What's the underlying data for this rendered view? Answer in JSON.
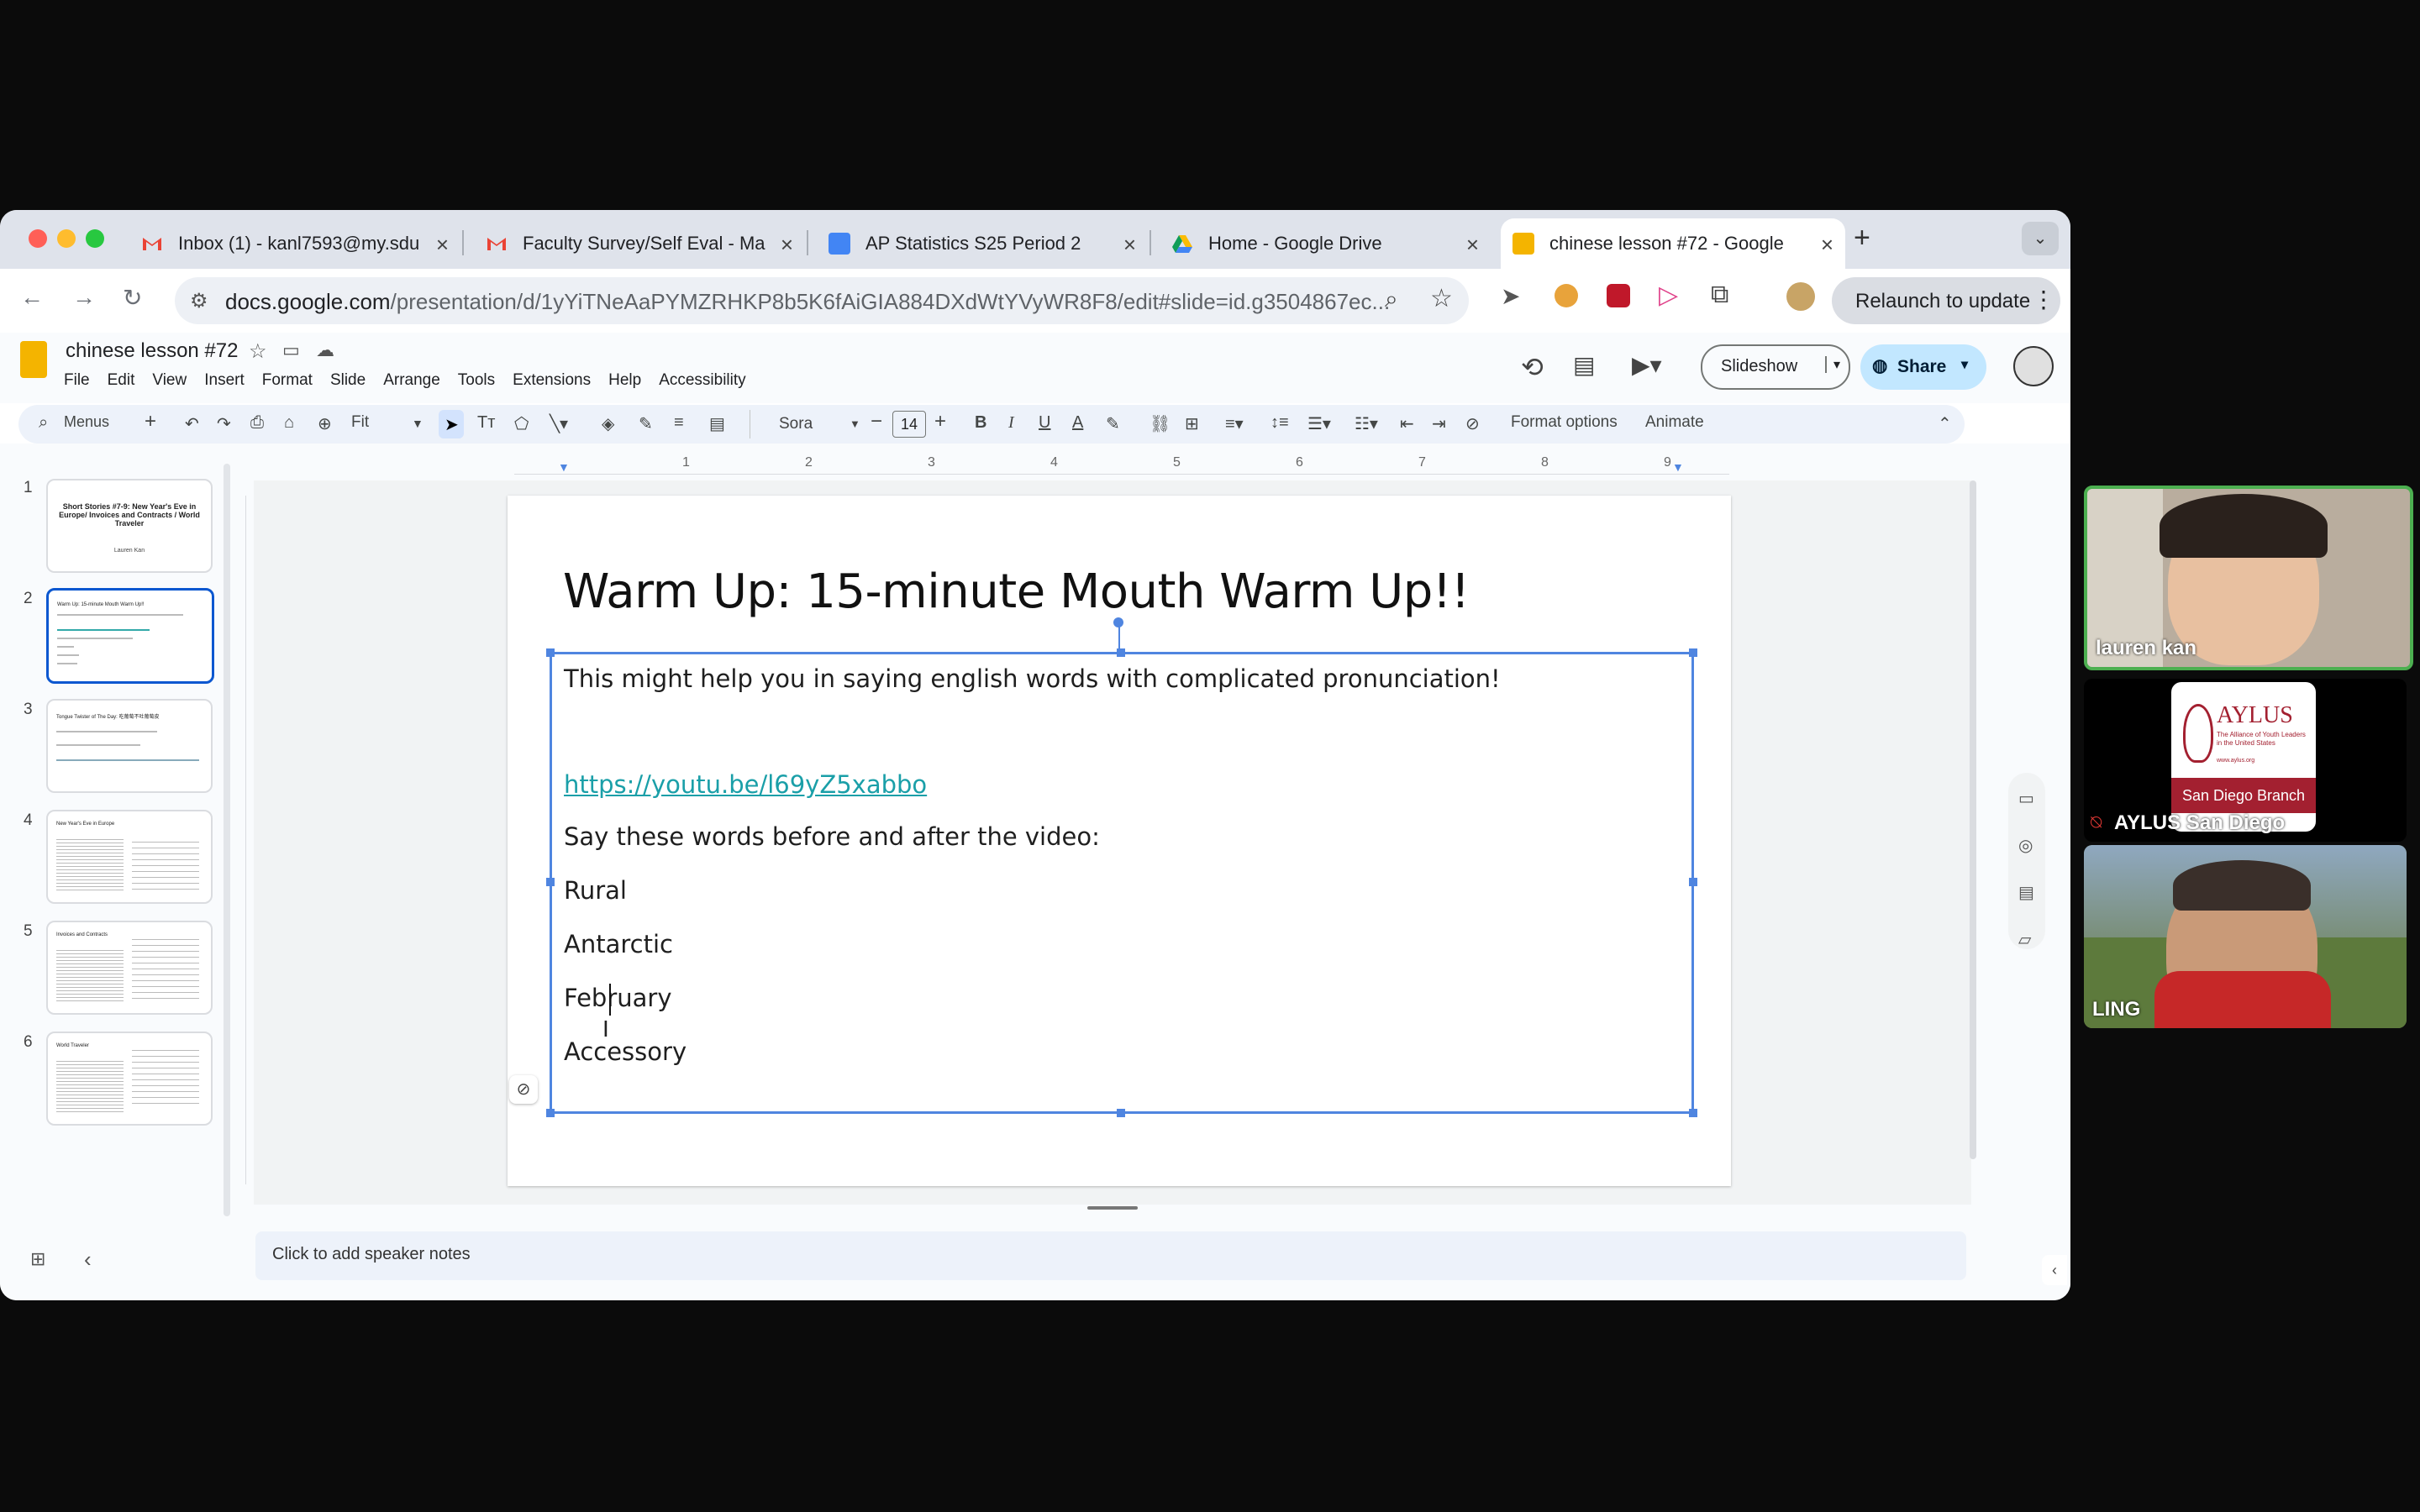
{
  "browser": {
    "tabs": [
      {
        "label": "Inbox (1) - kanl7593@my.sdu",
        "icon": "gmail-icon"
      },
      {
        "label": "Faculty Survey/Self Eval - Ma",
        "icon": "gmail-icon"
      },
      {
        "label": "AP Statistics S25 Period 2",
        "icon": "classroom-icon"
      },
      {
        "label": "Home - Google Drive",
        "icon": "drive-icon"
      },
      {
        "label": "chinese lesson #72 - Google",
        "icon": "slides-icon"
      }
    ],
    "url_domain": "docs.google.com",
    "url_path": "/presentation/d/1yYiTNeAaPYMZRHKP8b5K6fAiGIA884DXdWtYVyWR8F8/edit#slide=id.g3504867ec...",
    "relaunch_label": "Relaunch to update"
  },
  "app": {
    "doc_title": "chinese lesson #72",
    "menus": [
      "File",
      "Edit",
      "View",
      "Insert",
      "Format",
      "Slide",
      "Arrange",
      "Tools",
      "Extensions",
      "Help",
      "Accessibility"
    ],
    "slideshow_label": "Slideshow",
    "share_label": "Share",
    "toolbar": {
      "menus_label": "Menus",
      "zoom": "Fit",
      "font": "Sora",
      "font_size": "14",
      "format_options": "Format options",
      "animate": "Animate"
    },
    "ruler_ticks": [
      "1",
      "2",
      "3",
      "4",
      "5",
      "6",
      "7",
      "8",
      "9"
    ],
    "speaker_notes_placeholder": "Click to add speaker notes"
  },
  "thumbnails": [
    {
      "num": "1",
      "title": "Short Stories #7-9: New Year's Eve in Europe/ Invoices and Contracts / World Traveler",
      "author": "Lauren Kan"
    },
    {
      "num": "2",
      "title": "Warm Up: 15-minute Mouth Warm Up!!"
    },
    {
      "num": "3",
      "title": "Tongue Twister of The Day: 吃葡萄不吐葡萄皮"
    },
    {
      "num": "4",
      "title": "New Year's Eve in Europe"
    },
    {
      "num": "5",
      "title": "Invoices and Contracts"
    },
    {
      "num": "6",
      "title": "World Traveler"
    }
  ],
  "slide": {
    "title": "Warm Up: 15-minute Mouth Warm Up!!",
    "intro": "This might help you in saying english words with complicated pronunciation!",
    "link": "https://youtu.be/l69yZ5xabbo",
    "instruction": "Say these words before and after the video:",
    "words": [
      "Rural",
      "Antarctic",
      "February",
      "Accessory"
    ]
  },
  "participants": [
    {
      "name": "lauren kan",
      "active": true
    },
    {
      "name": "AYLUS San Diego",
      "muted": true,
      "logo_text": "AYLUS",
      "logo_sub": "The Alliance of Youth Leaders in the United States",
      "logo_url": "www.aylus.org",
      "branch": "San Diego Branch"
    },
    {
      "name": "LING"
    }
  ],
  "colors": {
    "accent": "#4f85e0",
    "share": "#c2e7ff",
    "link": "#1a9fa8",
    "active_speaker": "#4caf50"
  }
}
